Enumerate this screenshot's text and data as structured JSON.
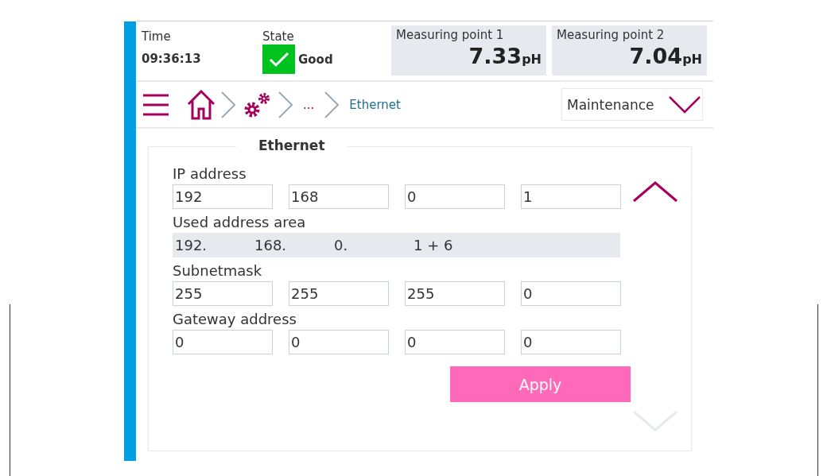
{
  "header": {
    "time_label": "Time",
    "time": "09:36:13",
    "state_label": "State",
    "state": {
      "text": "Good",
      "ok": true
    }
  },
  "measuring_points": [
    {
      "title": "Measuring point 1",
      "value": "7.33",
      "unit": "pH"
    },
    {
      "title": "Measuring point 2",
      "value": "7.04",
      "unit": "pH"
    }
  ],
  "breadcrumb": {
    "items": [
      {
        "kind": "home"
      },
      {
        "kind": "settings"
      },
      {
        "kind": "text",
        "label": "..."
      },
      {
        "kind": "current",
        "label": "Ethernet"
      }
    ]
  },
  "mode": {
    "value": "Maintenance"
  },
  "section": {
    "title": "Ethernet",
    "groups": [
      {
        "label": "IP address",
        "kind": "inputs",
        "values": [
          "192",
          "168",
          "0",
          "1"
        ]
      },
      {
        "label": "Used address area",
        "kind": "readonly",
        "values": [
          "192.",
          "168.",
          "0.",
          "1 + 6"
        ]
      },
      {
        "label": "Subnetmask",
        "kind": "inputs",
        "values": [
          "255",
          "255",
          "255",
          "0"
        ]
      },
      {
        "label": "Gateway address",
        "kind": "inputs",
        "values": [
          "0",
          "0",
          "0",
          "0"
        ]
      }
    ],
    "apply": "Apply",
    "scroll_up_enabled": true,
    "scroll_down_enabled": false
  }
}
